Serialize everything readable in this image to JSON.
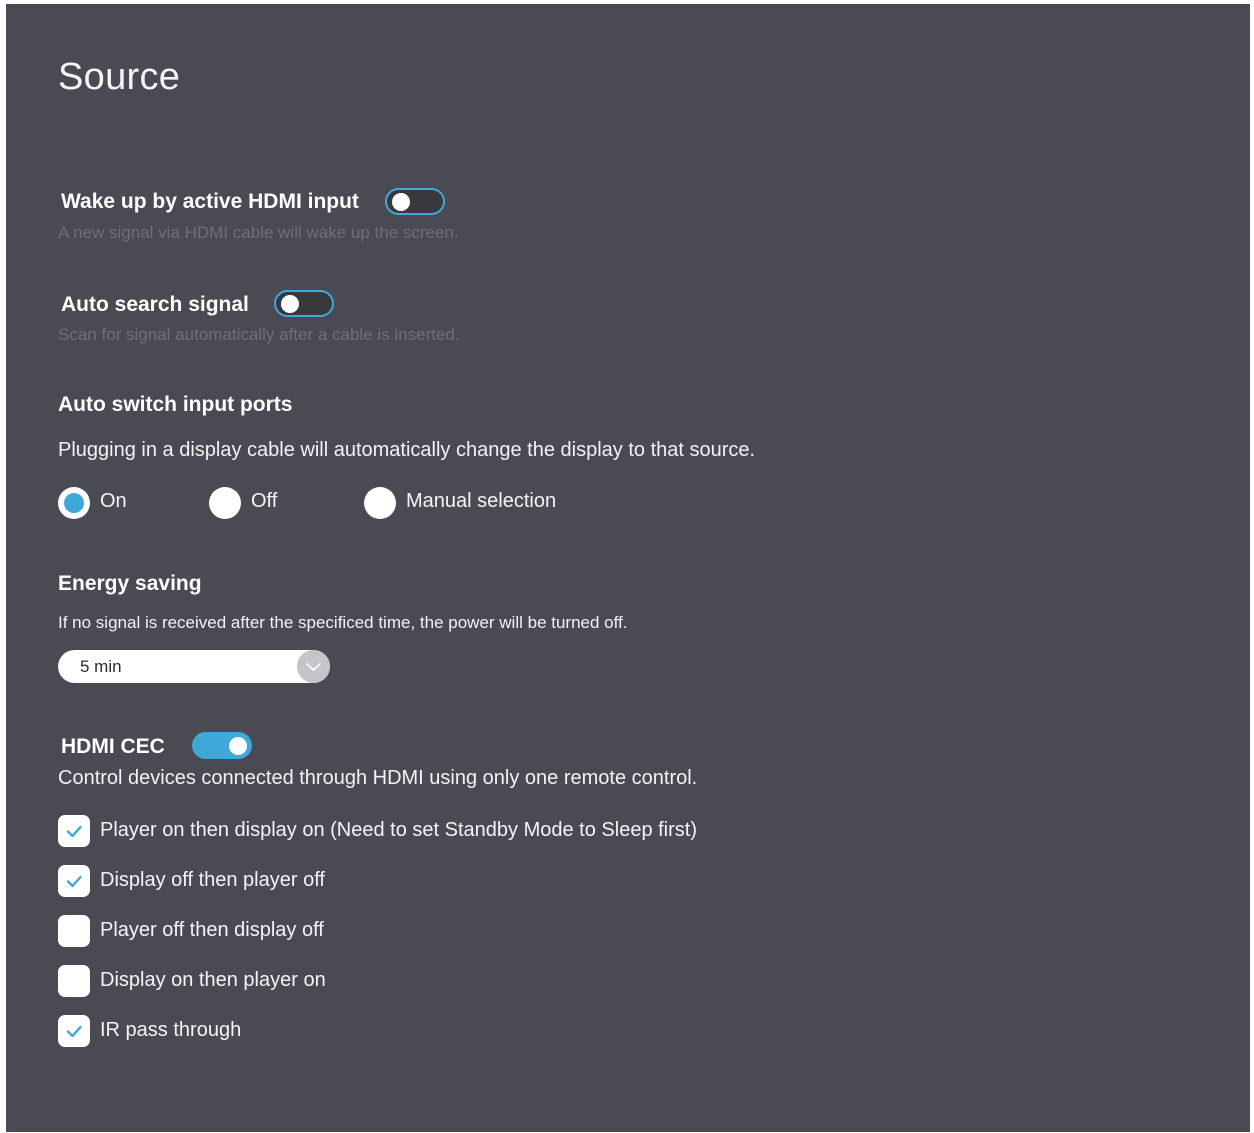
{
  "page": {
    "title": "Source"
  },
  "wake_hdmi": {
    "label": "Wake up by active HDMI input",
    "description": "A new signal via HDMI cable will wake up the screen.",
    "enabled": false
  },
  "auto_search": {
    "label": "Auto search signal",
    "description": "Scan for signal automatically after a cable is inserted.",
    "enabled": false
  },
  "auto_switch": {
    "label": "Auto switch input ports",
    "description": "Plugging in a display cable will automatically change the display to that source.",
    "options": [
      "On",
      "Off",
      "Manual selection"
    ],
    "selected": "On"
  },
  "energy_saving": {
    "label": "Energy saving",
    "description": "If no signal is received after the specificed time, the power will be turned off.",
    "selected_value": "5 min"
  },
  "hdmi_cec": {
    "label": "HDMI CEC",
    "enabled": true,
    "description": "Control devices connected through HDMI using only one remote control.",
    "options": [
      {
        "label": "Player on then display on (Need to set Standby Mode to Sleep first)",
        "checked": true
      },
      {
        "label": "Display off then player off",
        "checked": true
      },
      {
        "label": "Player off then display off",
        "checked": false
      },
      {
        "label": "Display on then player on",
        "checked": false
      },
      {
        "label": "IR pass through",
        "checked": true
      }
    ]
  },
  "colors": {
    "panel_bg": "#4a4a53",
    "accent": "#3ea8d8",
    "dim_text": "#6f6f79"
  },
  "icons": {
    "dropdown": "chevron-down-icon",
    "check": "checkmark-icon"
  }
}
